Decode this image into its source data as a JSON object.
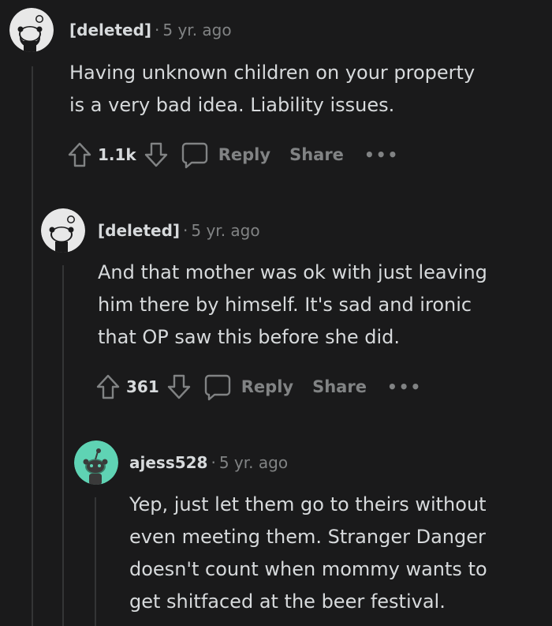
{
  "comments": [
    {
      "author": "[deleted]",
      "separator": "·",
      "time": "5 yr. ago",
      "lines": [
        "Having unknown children on your property",
        "is a very bad idea. Liability issues."
      ],
      "votes": "1.1k",
      "reply_label": "Reply",
      "share_label": "Share",
      "more_label": "•••",
      "avatar_color": "#e8e8e8"
    },
    {
      "author": "[deleted]",
      "separator": "·",
      "time": "5 yr. ago",
      "lines": [
        "And that mother was ok with just leaving",
        "him there by himself. It's sad and ironic",
        "that OP saw this before she did."
      ],
      "votes": "361",
      "reply_label": "Reply",
      "share_label": "Share",
      "more_label": "•••",
      "avatar_color": "#e8e8e8"
    },
    {
      "author": "ajess528",
      "separator": "·",
      "time": "5 yr. ago",
      "lines": [
        "Yep, just let them go to theirs without",
        "even meeting them. Stranger Danger",
        "doesn't count when mommy wants to",
        "get shitfaced at the beer festival."
      ],
      "avatar_color": "#5fd3b4"
    }
  ],
  "colors": {
    "background": "#1a1a1b",
    "text": "#d7dadc",
    "muted": "#818384",
    "thread_line": "#343536"
  }
}
